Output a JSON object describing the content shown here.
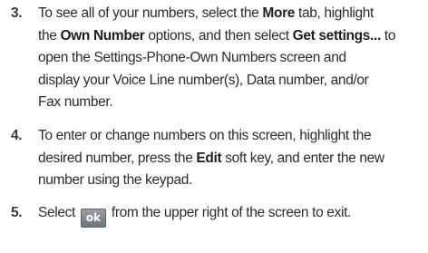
{
  "steps": [
    {
      "number": "3.",
      "lines": [
        {
          "t1": "To see all of your numbers, select the ",
          "b1": "More",
          "t2": " tab, highlight"
        },
        {
          "t1": "the ",
          "b1": "Own Number",
          "t2": " options, and then select ",
          "b2": "Get settings...",
          "t3": " to"
        },
        {
          "t1": "open the Settings-Phone-Own Numbers screen and"
        },
        {
          "t1": "display your Voice Line number(s), Data number, and/or"
        },
        {
          "t1": "Fax number."
        }
      ]
    },
    {
      "number": "4.",
      "lines": [
        {
          "t1": "To enter or change numbers on this screen, highlight the"
        },
        {
          "t1": "desired number, press the ",
          "b1": "Edit",
          "t2": " soft key, and enter the new"
        },
        {
          "t1": "number using the keypad."
        }
      ]
    },
    {
      "number": "5.",
      "lines": [
        {
          "t1": "Select ",
          "button": "ok",
          "t2": " from the upper right of the screen to exit."
        }
      ]
    }
  ]
}
